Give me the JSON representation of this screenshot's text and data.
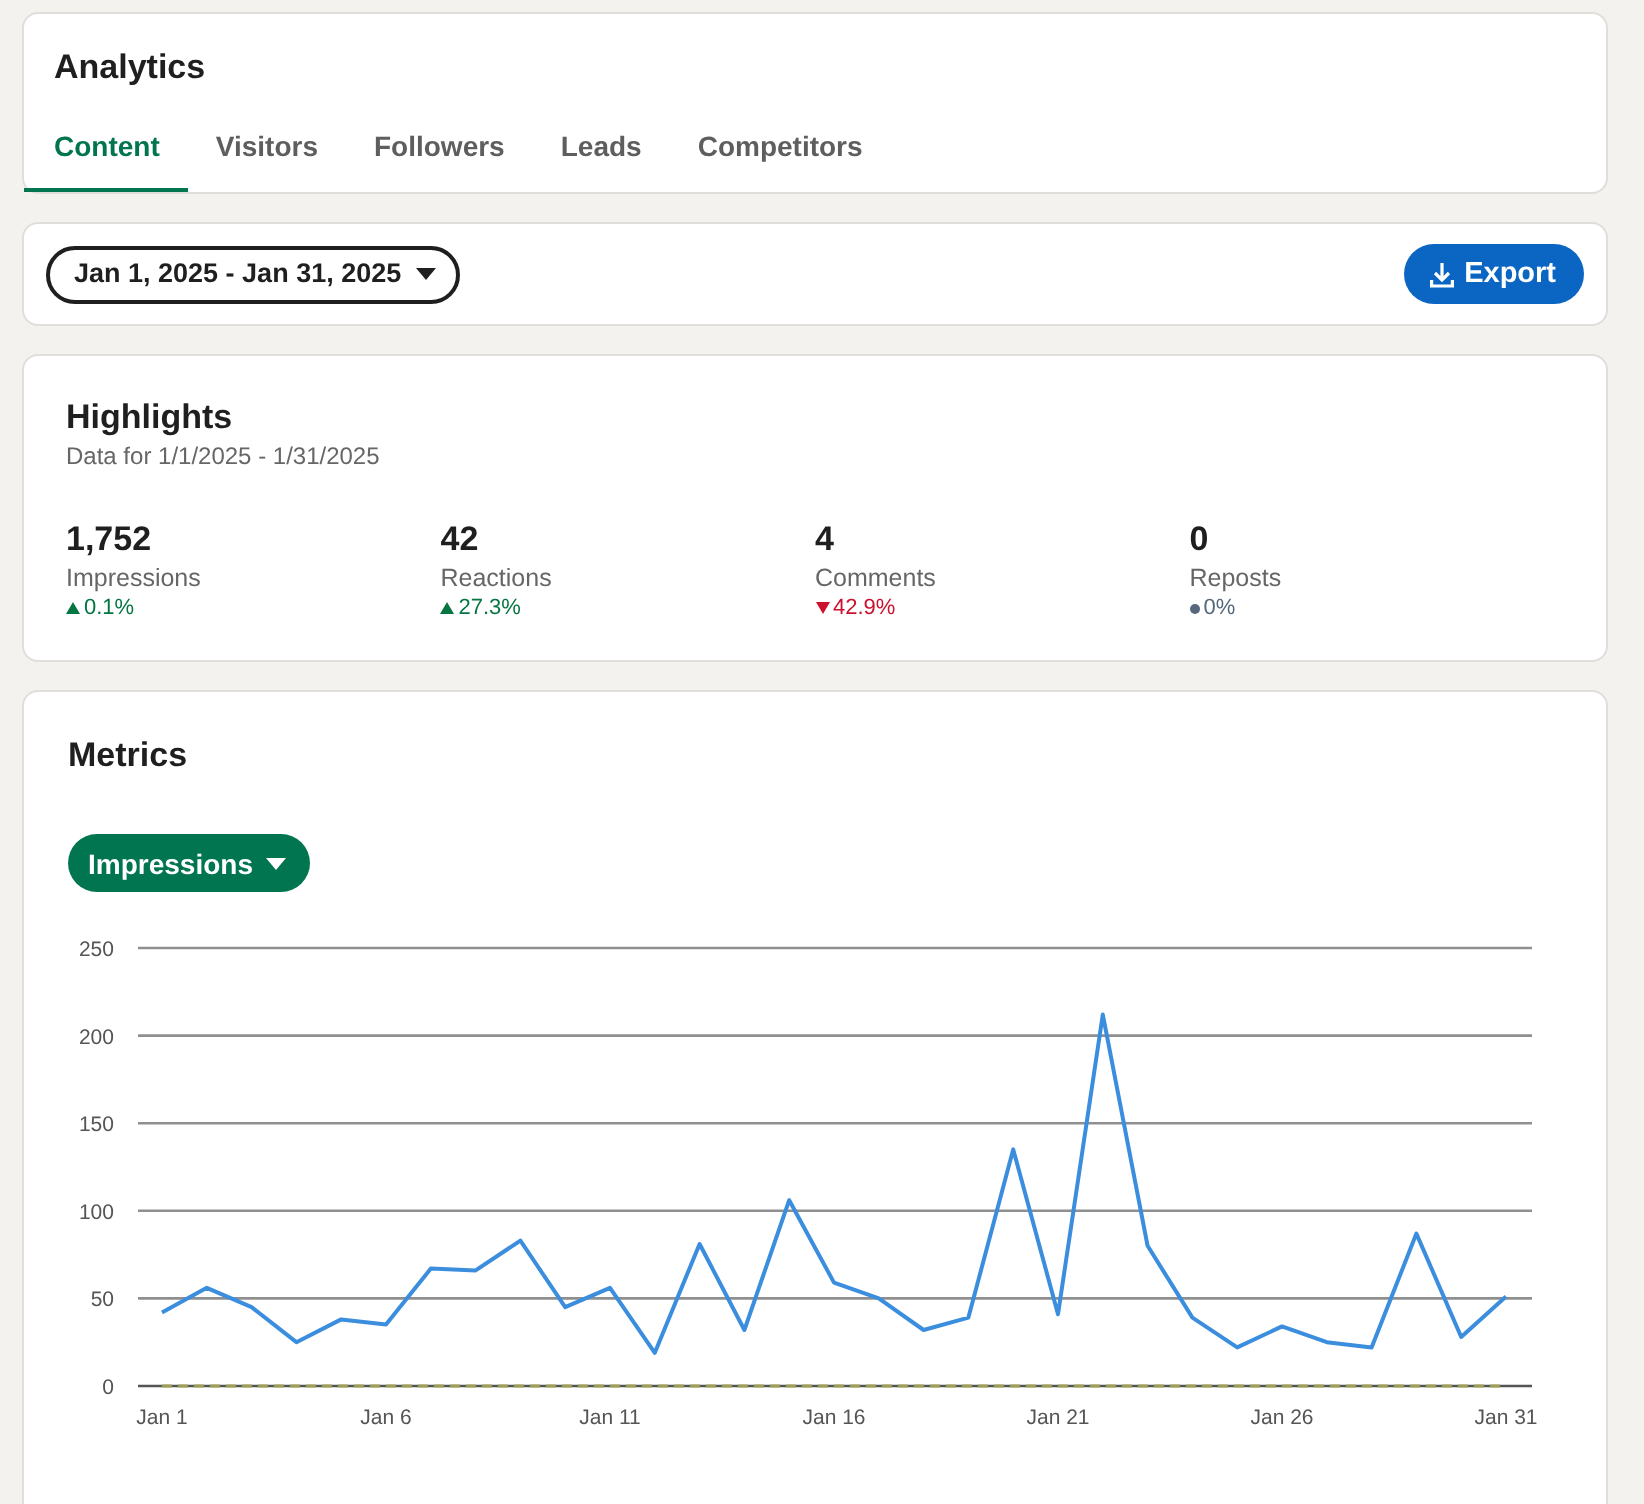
{
  "header": {
    "title": "Analytics"
  },
  "tabs": [
    {
      "label": "Content",
      "selected": true
    },
    {
      "label": "Visitors",
      "selected": false
    },
    {
      "label": "Followers",
      "selected": false
    },
    {
      "label": "Leads",
      "selected": false
    },
    {
      "label": "Competitors",
      "selected": false
    }
  ],
  "toolbar": {
    "date_range": "Jan 1, 2025 - Jan 31, 2025",
    "export_button": "Export"
  },
  "highlights": {
    "title": "Highlights",
    "subtitle": "Data for 1/1/2025 - 1/31/2025",
    "stats": [
      {
        "value": "1,752",
        "label": "Impressions",
        "change": "0.1%",
        "kind": "up"
      },
      {
        "value": "42",
        "label": "Reactions",
        "change": "27.3%",
        "kind": "up"
      },
      {
        "value": "4",
        "label": "Comments",
        "change": "42.9%",
        "kind": "down"
      },
      {
        "value": "0",
        "label": "Reposts",
        "change": "0%",
        "kind": "flat"
      }
    ]
  },
  "metrics": {
    "title": "Metrics",
    "metric_selector": "Impressions",
    "chart_data": {
      "type": "line",
      "categories": [
        "Jan 1",
        null,
        null,
        null,
        null,
        "Jan 6",
        null,
        null,
        null,
        null,
        "Jan 11",
        null,
        null,
        null,
        null,
        "Jan 16",
        null,
        null,
        null,
        null,
        "Jan 21",
        null,
        null,
        null,
        null,
        "Jan 26",
        null,
        null,
        null,
        null,
        "Jan 31"
      ],
      "ylim": [
        0,
        250
      ],
      "yticks": [
        0,
        50,
        100,
        150,
        200,
        250
      ],
      "grid": true,
      "series": [
        {
          "color": "#3b8ede",
          "values": [
            42,
            56,
            45,
            25,
            38,
            35,
            67,
            66,
            83,
            45,
            56,
            19,
            81,
            32,
            106,
            59,
            50,
            32,
            39,
            135,
            41,
            212,
            80,
            39,
            22,
            34,
            25,
            22,
            87,
            28,
            51
          ]
        },
        {
          "color": "#9e9e52",
          "line_style": "dashed",
          "values": [
            0,
            0,
            0,
            0,
            0,
            0,
            0,
            0,
            0,
            0,
            0,
            0,
            0,
            0,
            0,
            0,
            0,
            0,
            0,
            0,
            0,
            0,
            0,
            0,
            0,
            0,
            0,
            0,
            0,
            0,
            0
          ]
        }
      ]
    }
  }
}
